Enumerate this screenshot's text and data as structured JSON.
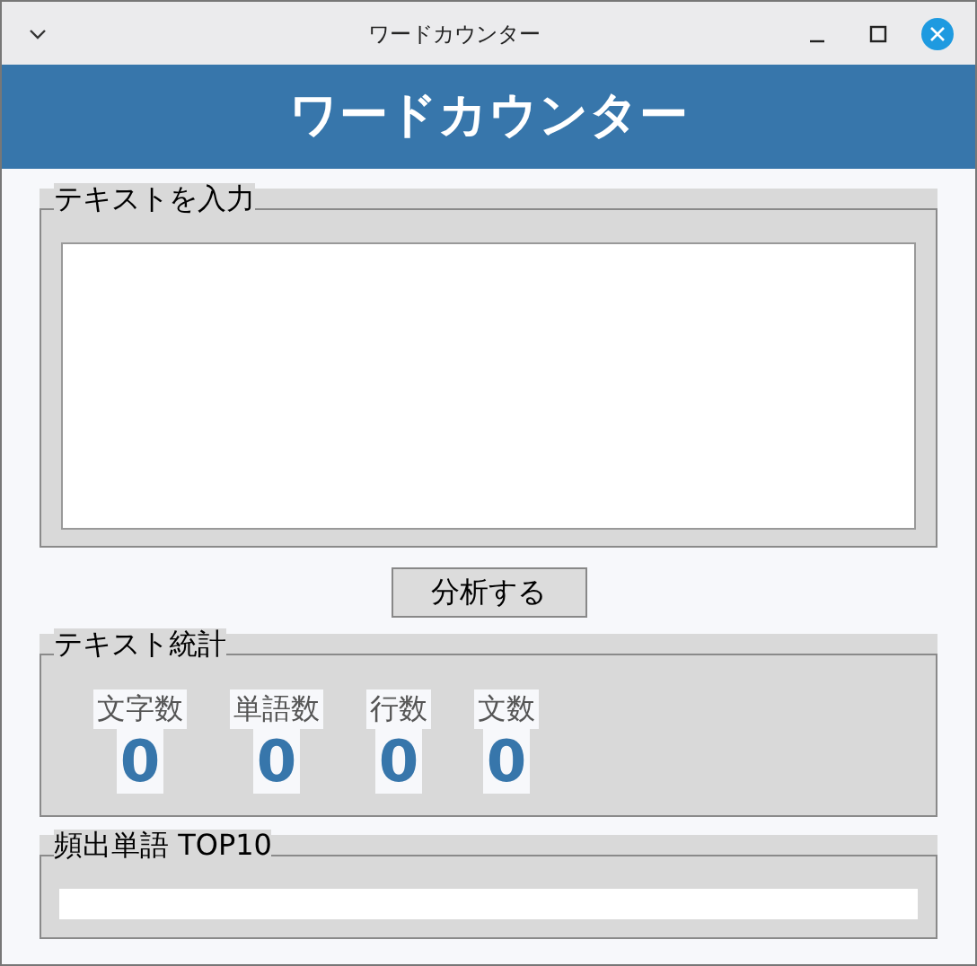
{
  "window": {
    "title": "ワードカウンター"
  },
  "header": {
    "title": "ワードカウンター"
  },
  "input_section": {
    "label": "テキストを入力"
  },
  "analyze_button": {
    "label": "分析する"
  },
  "stats_section": {
    "label": "テキスト統計",
    "stats": [
      {
        "label": "文字数",
        "value": "0"
      },
      {
        "label": "単語数",
        "value": "0"
      },
      {
        "label": "行数",
        "value": "0"
      },
      {
        "label": "文数",
        "value": "0"
      }
    ]
  },
  "top_words_section": {
    "label": "頻出単語 TOP10"
  }
}
